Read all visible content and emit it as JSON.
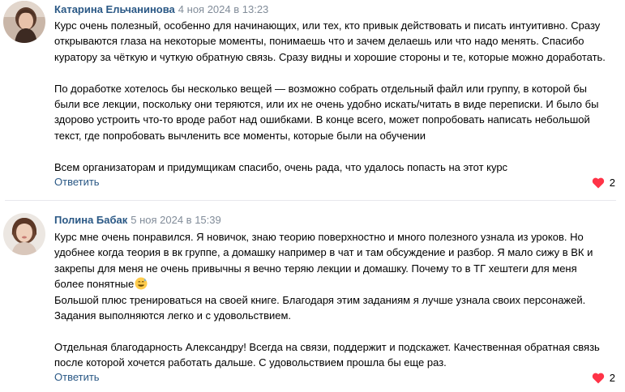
{
  "comments": [
    {
      "author": "Катарина Ельчанинова",
      "date": "4 ноя 2024 в 13:23",
      "lines": [
        "Курс очень полезный, особенно для начинающих, или тех, кто привык действовать и писать интуитивно. Сразу",
        "открываются глаза на некоторые моменты, понимаешь что и зачем делаешь или что надо менять. Спасибо",
        "куратору за чёткую и чуткую обратную связь. Сразу видны и хорошие стороны и те, которые можно доработать.",
        "",
        "По доработке хотелось бы несколько вещей — возможно собрать отдельный файл или группу, в которой бы",
        "были все лекции, поскольку они теряются, или их не очень удобно искать/читать в виде переписки. И было бы",
        "здорово устроить что-то вроде работ над ошибками. В конце всего, может попробовать написать небольшой",
        "текст, где попробовать вычленить все моменты, которые были на обучении",
        "",
        "Всем организаторам и придумщикам спасибо, очень рада, что удалось попасть на этот курс"
      ],
      "reply_label": "Ответить",
      "likes": "2"
    },
    {
      "author": "Полина Бабак",
      "date": "5 ноя 2024 в 15:39",
      "lines": [
        "Курс мне очень понравился. Я новичок, знаю теорию поверхностно и много полезного узнала из уроков. Но",
        "удобнее когда теория в вк группе, а домашку например в чат и там обсуждение и разбор. Я мало сижу в ВК и",
        "закрепы для меня не очень привычны я вечно теряю лекции и домашку. Почему то в ТГ хештеги для меня",
        "более понятные",
        "Большой плюс тренироваться на своей книге. Благодаря этим заданиям я лучше узнала своих персонажей.",
        "Задания выполняются легко и с удовольствием.",
        "",
        "Отдельная благодарность Александру! Всегда на связи, поддержит и подскажет. Качественная обратная связь",
        "после которой хочется работать дальше. С удовольствием прошла бы еще раз."
      ],
      "reply_label": "Ответить",
      "likes": "2",
      "emoji_icon": "sweat-smile-emoji-icon"
    }
  ],
  "colors": {
    "author": "#2a5885",
    "date": "#818c99",
    "like_heart": "#ff3347",
    "divider": "#e7e8ec"
  }
}
